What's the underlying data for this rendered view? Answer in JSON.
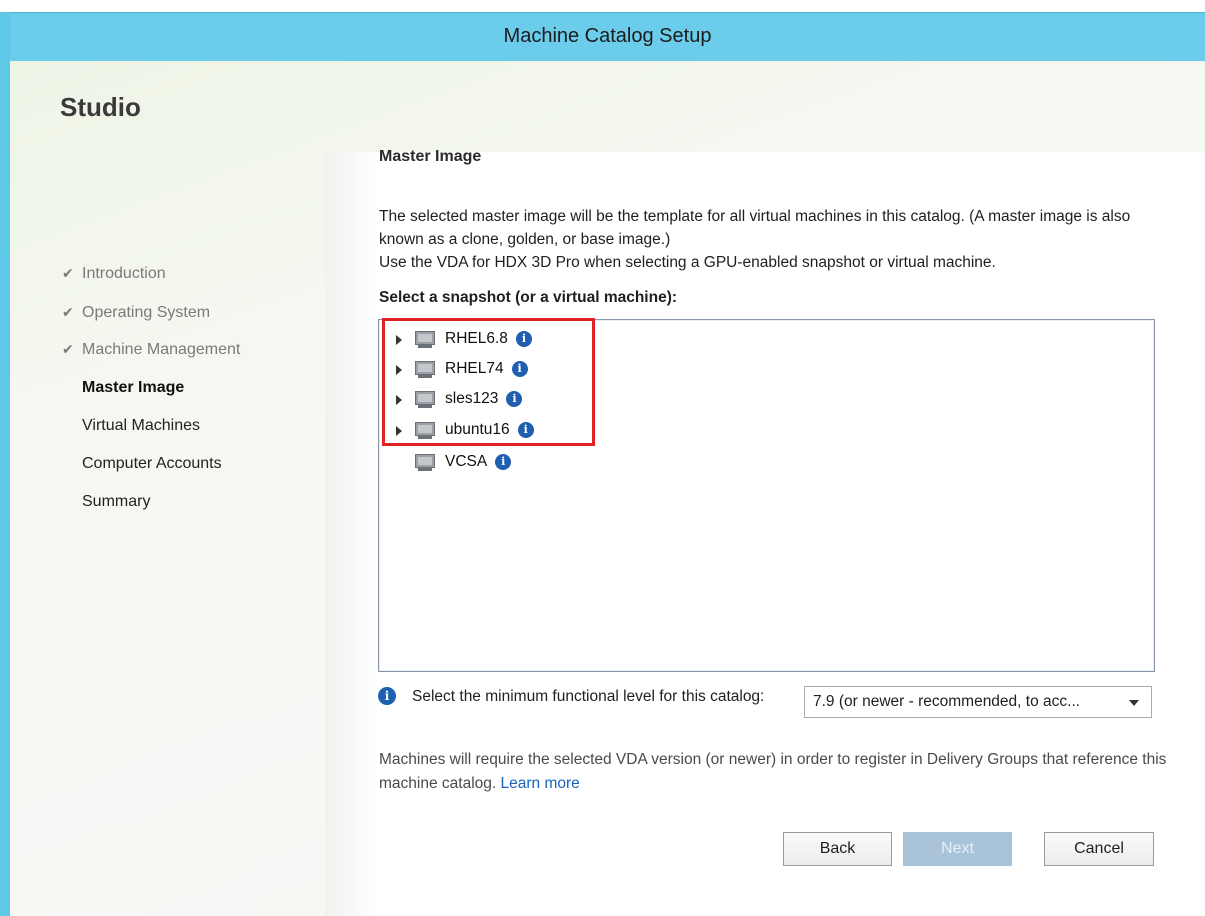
{
  "window": {
    "title": "Machine Catalog Setup"
  },
  "sidebar": {
    "app_title": "Studio",
    "steps": [
      {
        "label": "Introduction",
        "state": "done"
      },
      {
        "label": "Operating System",
        "state": "done"
      },
      {
        "label": "Machine Management",
        "state": "done"
      },
      {
        "label": "Master Image",
        "state": "active"
      },
      {
        "label": "Virtual Machines",
        "state": "pending"
      },
      {
        "label": "Computer Accounts",
        "state": "pending"
      },
      {
        "label": "Summary",
        "state": "pending"
      }
    ]
  },
  "main": {
    "heading": "Master Image",
    "description_line1": "The selected master image will be the template for all virtual machines in this catalog. (A master image is also known as a clone, golden, or base image.)",
    "description_line2": "Use the VDA for HDX 3D Pro when selecting a GPU-enabled snapshot or virtual machine.",
    "select_label": "Select a snapshot (or a virtual machine):",
    "tree_items": [
      {
        "label": "RHEL6.8",
        "expandable": true
      },
      {
        "label": "RHEL74",
        "expandable": true
      },
      {
        "label": "sles123",
        "expandable": true
      },
      {
        "label": "ubuntu16",
        "expandable": true
      },
      {
        "label": "VCSA",
        "expandable": false
      }
    ],
    "functional_level_label": "Select the minimum functional level for this catalog:",
    "functional_level_value": "7.9 (or newer - recommended, to acc...",
    "note_text": "Machines will require the selected VDA version (or newer) in order to register in Delivery Groups that reference this machine catalog.",
    "note_link": "Learn more"
  },
  "buttons": {
    "back": "Back",
    "next": "Next",
    "cancel": "Cancel"
  },
  "colors": {
    "title_bar": "#6bcceb",
    "highlight": "#e02222",
    "info": "#1f5fb0",
    "link": "#1a64b8"
  }
}
